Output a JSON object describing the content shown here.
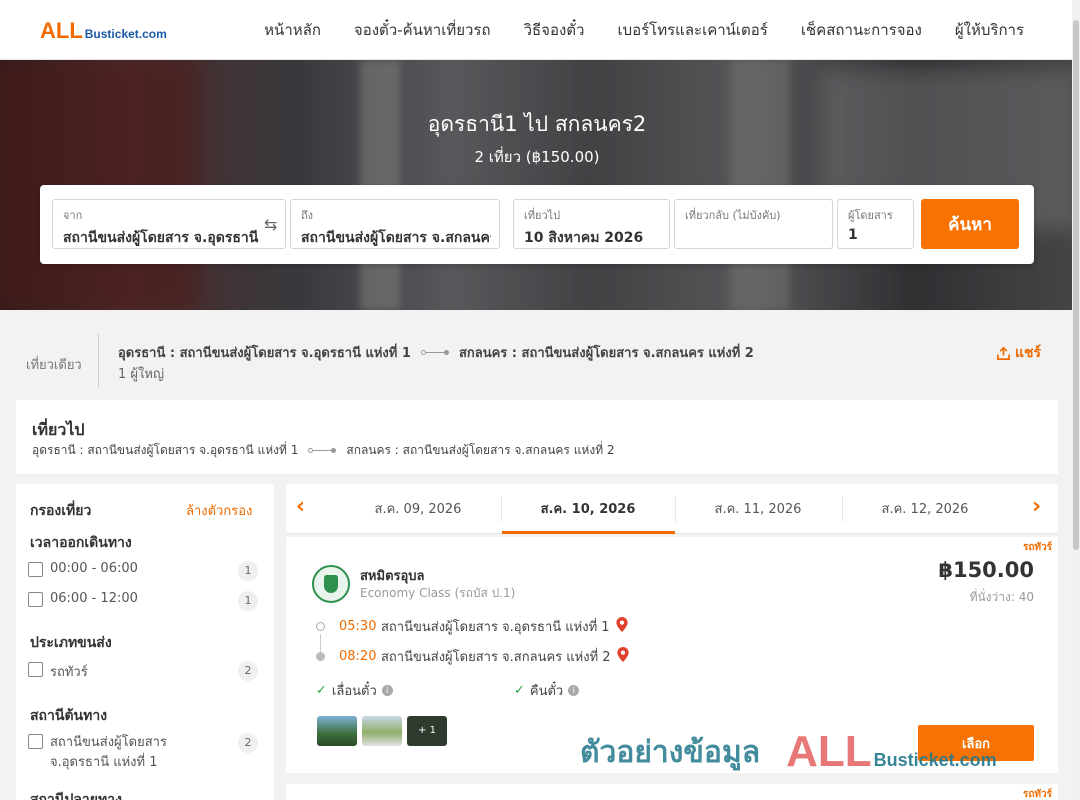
{
  "brand": {
    "logo_big": "ALL",
    "logo_small": "Busticket.com"
  },
  "nav": {
    "home": "หน้าหลัก",
    "book": "จองตั๋ว-ค้นหาเที่ยวรถ",
    "howto": "วิธีจองตั๋ว",
    "contact": "เบอร์โทรและเคาน์เตอร์",
    "status": "เช็คสถานะการจอง",
    "operators": "ผู้ให้บริการ"
  },
  "hero": {
    "title": "อุดรธานี1 ไป สกลนคร2",
    "subtitle": "2 เที่ยว (฿150.00)"
  },
  "search": {
    "from_label": "จาก",
    "from_value": "สถานีขนส่งผู้โดยสาร จ.อุดรธานี",
    "to_label": "ถึง",
    "to_value": "สถานีขนส่งผู้โดยสาร จ.สกลนคร",
    "depart_label": "เที่ยวไป",
    "depart_value": "10 สิงหาคม 2026",
    "return_label": "เที่ยวกลับ (ไม่บังคับ)",
    "return_value": "",
    "pax_label": "ผู้โดยสาร",
    "pax_value": "1",
    "button": "ค้นหา"
  },
  "summary": {
    "trip_type": "เที่ยวเดียว",
    "origin": "อุดรธานี : สถานีขนส่งผู้โดยสาร จ.อุดรธานี แห่งที่ 1",
    "destination": "สกลนคร : สถานีขนส่งผู้โดยสาร จ.สกลนคร แห่งที่ 2",
    "passengers": "1 ผู้ใหญ่",
    "share": "แชร์"
  },
  "outbound": {
    "title": "เที่ยวไป",
    "origin": "อุดรธานี : สถานีขนส่งผู้โดยสาร จ.อุดรธานี แห่งที่ 1",
    "destination": "สกลนคร : สถานีขนส่งผู้โดยสาร จ.สกลนคร แห่งที่ 2"
  },
  "filters": {
    "title": "กรองเที่ยว",
    "clear": "ล้างตัวกรอง",
    "departure_time": {
      "heading": "เวลาออกเดินทาง",
      "items": [
        {
          "label": "00:00 - 06:00",
          "count": "1"
        },
        {
          "label": "06:00 - 12:00",
          "count": "1"
        }
      ]
    },
    "vehicle": {
      "heading": "ประเภทขนส่ง",
      "items": [
        {
          "label": "รถทัวร์",
          "count": "2"
        }
      ]
    },
    "origin_station": {
      "heading": "สถานีต้นทาง",
      "items": [
        {
          "label": "สถานีขนส่งผู้โดยสาร จ.อุดรธานี แห่งที่ 1",
          "count": "2"
        }
      ]
    },
    "dest_station": {
      "heading": "สถานีปลายทาง"
    }
  },
  "dates": [
    {
      "label": "ส.ค. 09, 2026"
    },
    {
      "label": "ส.ค. 10, 2026"
    },
    {
      "label": "ส.ค. 11, 2026"
    },
    {
      "label": "ส.ค. 12, 2026"
    }
  ],
  "trip": {
    "tag": "รถทัวร์",
    "operator": "สหมิตรอุบล",
    "class": "Economy Class (รถบัส ป.1)",
    "price": "฿150.00",
    "seats": "ที่นั่งว่าง: 40",
    "depart_time": "05:30",
    "depart_station": "สถานีขนส่งผู้โดยสาร จ.อุดรธานี แห่งที่ 1",
    "arrive_time": "08:20",
    "arrive_station": "สถานีขนส่งผู้โดยสาร จ.สกลนคร แห่งที่ 2",
    "reschedule": "เลื่อนตั๋ว",
    "refund": "คืนตั๋ว",
    "more_photos": "+ 1",
    "select": "เลือก"
  },
  "trip2": {
    "tag": "รถทัวร์"
  },
  "watermark": {
    "text": "ตัวอย่างข้อมูล",
    "logo_big": "ALL",
    "logo_small": "Busticket.com"
  },
  "colors": {
    "accent": "#f77200",
    "brand_blue": "#1b5aa8",
    "check_green": "#2aa84a"
  }
}
